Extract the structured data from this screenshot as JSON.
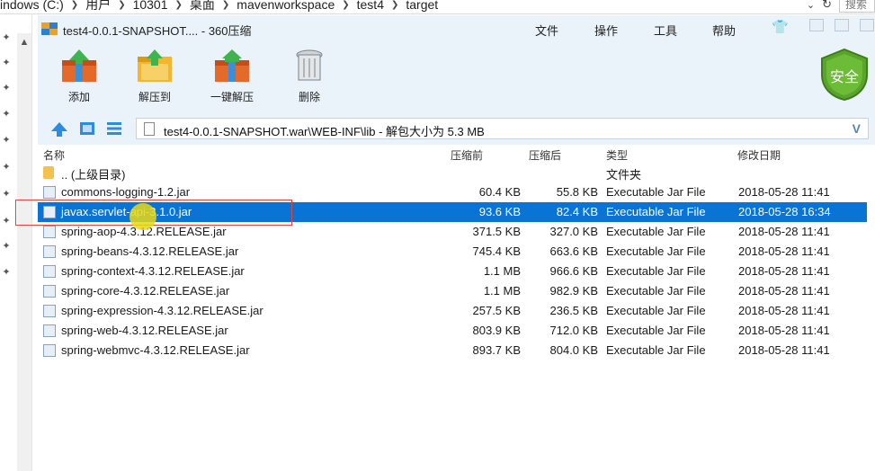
{
  "explorer": {
    "breadcrumb": [
      "indows (C:)",
      "用户",
      "10301",
      "桌面",
      "mavenworkspace",
      "test4",
      "target"
    ],
    "search_placeholder": "搜索"
  },
  "window": {
    "title": "test4-0.0.1-SNAPSHOT.... - 360压缩",
    "menu": [
      "文件",
      "操作",
      "工具",
      "帮助"
    ]
  },
  "toolbar": {
    "buttons": [
      {
        "label": "添加",
        "icon": "add-archive-icon"
      },
      {
        "label": "解压到",
        "icon": "extract-to-folder-icon"
      },
      {
        "label": "一键解压",
        "icon": "one-click-extract-icon"
      },
      {
        "label": "删除",
        "icon": "delete-trash-icon"
      }
    ],
    "security_badge": "安全"
  },
  "path": {
    "text": "test4-0.0.1-SNAPSHOT.war\\WEB-INF\\lib - 解包大小为 5.3 MB"
  },
  "columns": {
    "name": "名称",
    "before": "压缩前",
    "after": "压缩后",
    "type": "类型",
    "date": "修改日期"
  },
  "files": [
    {
      "name": ".. (上级目录)",
      "before": "",
      "after": "",
      "type": "文件夹",
      "date": "",
      "kind": "folder"
    },
    {
      "name": "commons-logging-1.2.jar",
      "before": "60.4 KB",
      "after": "55.8 KB",
      "type": "Executable Jar File",
      "date": "2018-05-28 11:41",
      "kind": "jar"
    },
    {
      "name": "javax.servlet-api-3.1.0.jar",
      "before": "93.6 KB",
      "after": "82.4 KB",
      "type": "Executable Jar File",
      "date": "2018-05-28 16:34",
      "kind": "jar",
      "selected": true
    },
    {
      "name": "spring-aop-4.3.12.RELEASE.jar",
      "before": "371.5 KB",
      "after": "327.0 KB",
      "type": "Executable Jar File",
      "date": "2018-05-28 11:41",
      "kind": "jar"
    },
    {
      "name": "spring-beans-4.3.12.RELEASE.jar",
      "before": "745.4 KB",
      "after": "663.6 KB",
      "type": "Executable Jar File",
      "date": "2018-05-28 11:41",
      "kind": "jar"
    },
    {
      "name": "spring-context-4.3.12.RELEASE.jar",
      "before": "1.1 MB",
      "after": "966.6 KB",
      "type": "Executable Jar File",
      "date": "2018-05-28 11:41",
      "kind": "jar"
    },
    {
      "name": "spring-core-4.3.12.RELEASE.jar",
      "before": "1.1 MB",
      "after": "982.9 KB",
      "type": "Executable Jar File",
      "date": "2018-05-28 11:41",
      "kind": "jar"
    },
    {
      "name": "spring-expression-4.3.12.RELEASE.jar",
      "before": "257.5 KB",
      "after": "236.5 KB",
      "type": "Executable Jar File",
      "date": "2018-05-28 11:41",
      "kind": "jar"
    },
    {
      "name": "spring-web-4.3.12.RELEASE.jar",
      "before": "803.9 KB",
      "after": "712.0 KB",
      "type": "Executable Jar File",
      "date": "2018-05-28 11:41",
      "kind": "jar"
    },
    {
      "name": "spring-webmvc-4.3.12.RELEASE.jar",
      "before": "893.7 KB",
      "after": "804.0 KB",
      "type": "Executable Jar File",
      "date": "2018-05-28 11:41",
      "kind": "jar"
    }
  ],
  "colors": {
    "selection": "#0a74d6",
    "chrome": "#eaf3fa",
    "highlight_box": "#e0473b",
    "security": "#5aa32c"
  }
}
